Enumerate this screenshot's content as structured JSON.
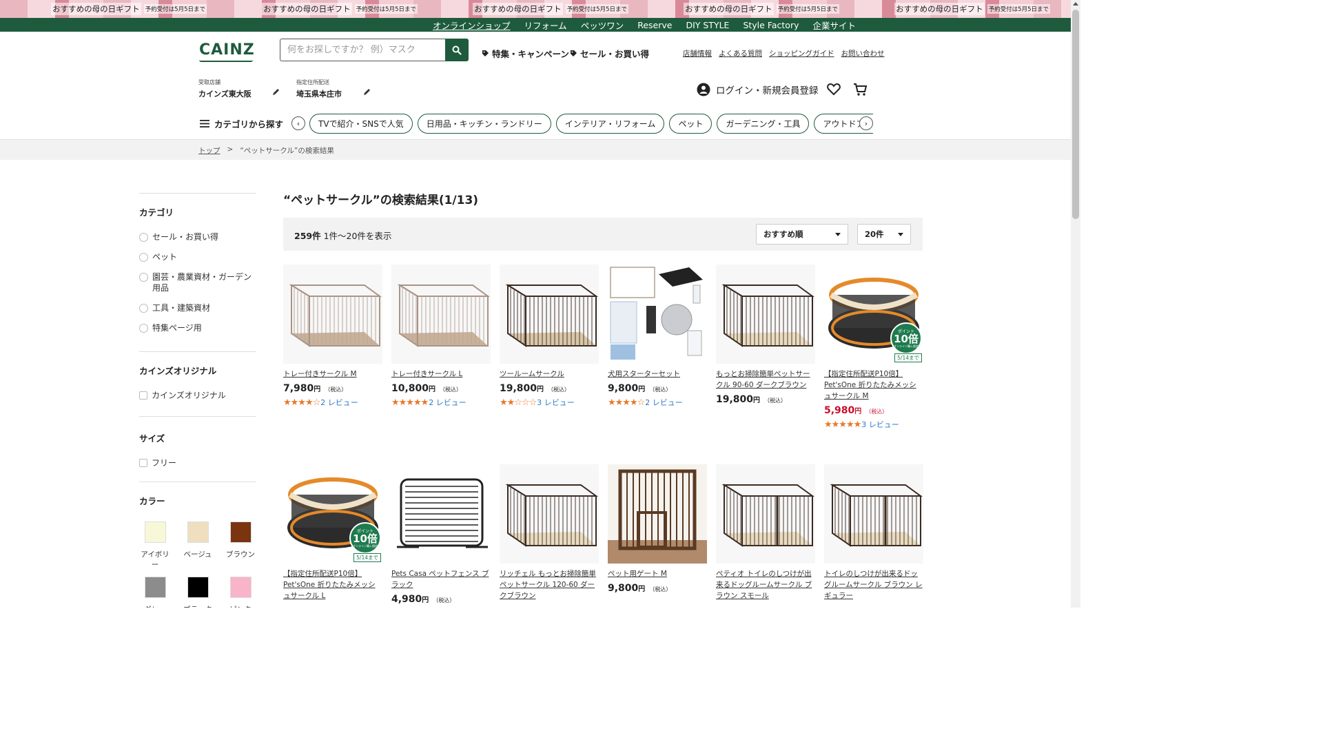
{
  "promo": {
    "main": "おすすめの母の日ギフト",
    "sub": "予約受付は5月5日まで"
  },
  "topnav": [
    {
      "label": "オンラインショップ",
      "active": true
    },
    {
      "label": "リフォーム"
    },
    {
      "label": "ペッツワン"
    },
    {
      "label": "Reserve"
    },
    {
      "label": "DIY STYLE"
    },
    {
      "label": "Style Factory"
    },
    {
      "label": "企業サイト"
    }
  ],
  "header": {
    "logo": "CAINZ",
    "search_placeholder": "何をお探しですか？ 例）マスク",
    "campaign_link": "特集・キャンペーン",
    "sale_link": "セール・お買い得",
    "util_links": [
      "店舗情報",
      "よくある質問",
      "ショッピングガイド",
      "お問い合わせ"
    ],
    "store_label": "受取店舗",
    "store_value": "カインズ東大阪",
    "delivery_label": "指定住所配送",
    "delivery_value": "埼玉県本庄市",
    "login_label": "ログイン・新規会員登録"
  },
  "categories": {
    "menu_label": "カテゴリから探す",
    "pills": [
      "TVで紹介・SNSで人気",
      "日用品・キッチン・ランドリー",
      "インテリア・リフォーム",
      "ペット",
      "ガーデニング・工具",
      "アウトドア・カー用品"
    ]
  },
  "breadcrumb": {
    "home": "トップ",
    "separator": ">",
    "current": "“ペットサークル”の検索結果"
  },
  "sidebar": {
    "category_title": "カテゴリ",
    "categories": [
      "セール・お買い得",
      "ペット",
      "園芸・農業資材・ガーデン用品",
      "工具・建築資材",
      "特集ページ用"
    ],
    "original_title": "カインズオリジナル",
    "original_option": "カインズオリジナル",
    "size_title": "サイズ",
    "size_option": "フリー",
    "color_title": "カラー",
    "colors": [
      {
        "name": "アイボリー",
        "hex": "#f8f8d8"
      },
      {
        "name": "ベージュ",
        "hex": "#efdfbf"
      },
      {
        "name": "ブラウン",
        "hex": "#7a3410"
      },
      {
        "name": "グレー",
        "hex": "#8c8c8c"
      },
      {
        "name": "ブラック",
        "hex": "#000000"
      },
      {
        "name": "ピンク",
        "hex": "#f8b4c8"
      }
    ]
  },
  "results": {
    "title": "“ペットサークル”の検索結果(1/13)",
    "count": "259件",
    "range": " 1件～20件を表示",
    "sort": "おすすめ順",
    "per_page": "20件",
    "yen": "円",
    "tax": "（税込）",
    "badge_label": "ポイント",
    "badge_num": "10倍",
    "badge_note": "オンライン購入限定",
    "badge_date": "5/14まで",
    "products": [
      {
        "name": "トレー付きサークル M",
        "price": "7,980",
        "stars": "★★★★☆",
        "reviews": "2 レビュー",
        "sale": false,
        "img": "pen-ivory"
      },
      {
        "name": "トレー付きサークル L",
        "price": "10,800",
        "stars": "★★★★★",
        "reviews": "2 レビュー",
        "sale": false,
        "img": "pen-ivory"
      },
      {
        "name": "ツールームサークル",
        "price": "19,800",
        "stars": "★★☆☆☆",
        "reviews": "3 レビュー",
        "sale": false,
        "img": "pen-dark"
      },
      {
        "name": "犬用スターターセット",
        "price": "9,800",
        "stars": "★★★★☆",
        "reviews": "2 レビュー",
        "sale": false,
        "img": "starter-set"
      },
      {
        "name": "もっとお掃除簡単ペットサークル 90-60 ダークブラウン",
        "price": "19,800",
        "stars": "",
        "reviews": "",
        "sale": false,
        "img": "pen-brown"
      },
      {
        "name": "【指定住所配送P10倍】Pet'sOne 折りたたみメッシュサークル M",
        "price": "5,980",
        "stars": "★★★★★",
        "reviews": "3 レビュー",
        "sale": true,
        "img": "mesh",
        "badge": true
      },
      {
        "name": "【指定住所配送P10倍】Pet'sOne 折りたたみメッシュサークル L",
        "price": "",
        "stars": "",
        "reviews": "",
        "sale": false,
        "img": "mesh",
        "badge": true
      },
      {
        "name": "Pets Casa ペットフェンス ブラック",
        "price": "4,980",
        "stars": "",
        "reviews": "",
        "sale": false,
        "img": "fence"
      },
      {
        "name": "リッチェル もっとお掃除簡単ペットサークル 120-60 ダークブラウン",
        "price": "",
        "stars": "",
        "reviews": "",
        "sale": false,
        "img": "pen-brown"
      },
      {
        "name": "ペット用ゲート M",
        "price": "9,800",
        "stars": "",
        "reviews": "",
        "sale": false,
        "img": "gate"
      },
      {
        "name": "ペティオ トイレのしつけが出来るドッグルームサークル ブラウン スモール",
        "price": "",
        "stars": "",
        "reviews": "",
        "sale": false,
        "img": "pen-room"
      },
      {
        "name": "トイレのしつけが出来るドッグルームサークル ブラウン レギュラー",
        "price": "",
        "stars": "",
        "reviews": "",
        "sale": false,
        "img": "pen-room"
      }
    ]
  }
}
